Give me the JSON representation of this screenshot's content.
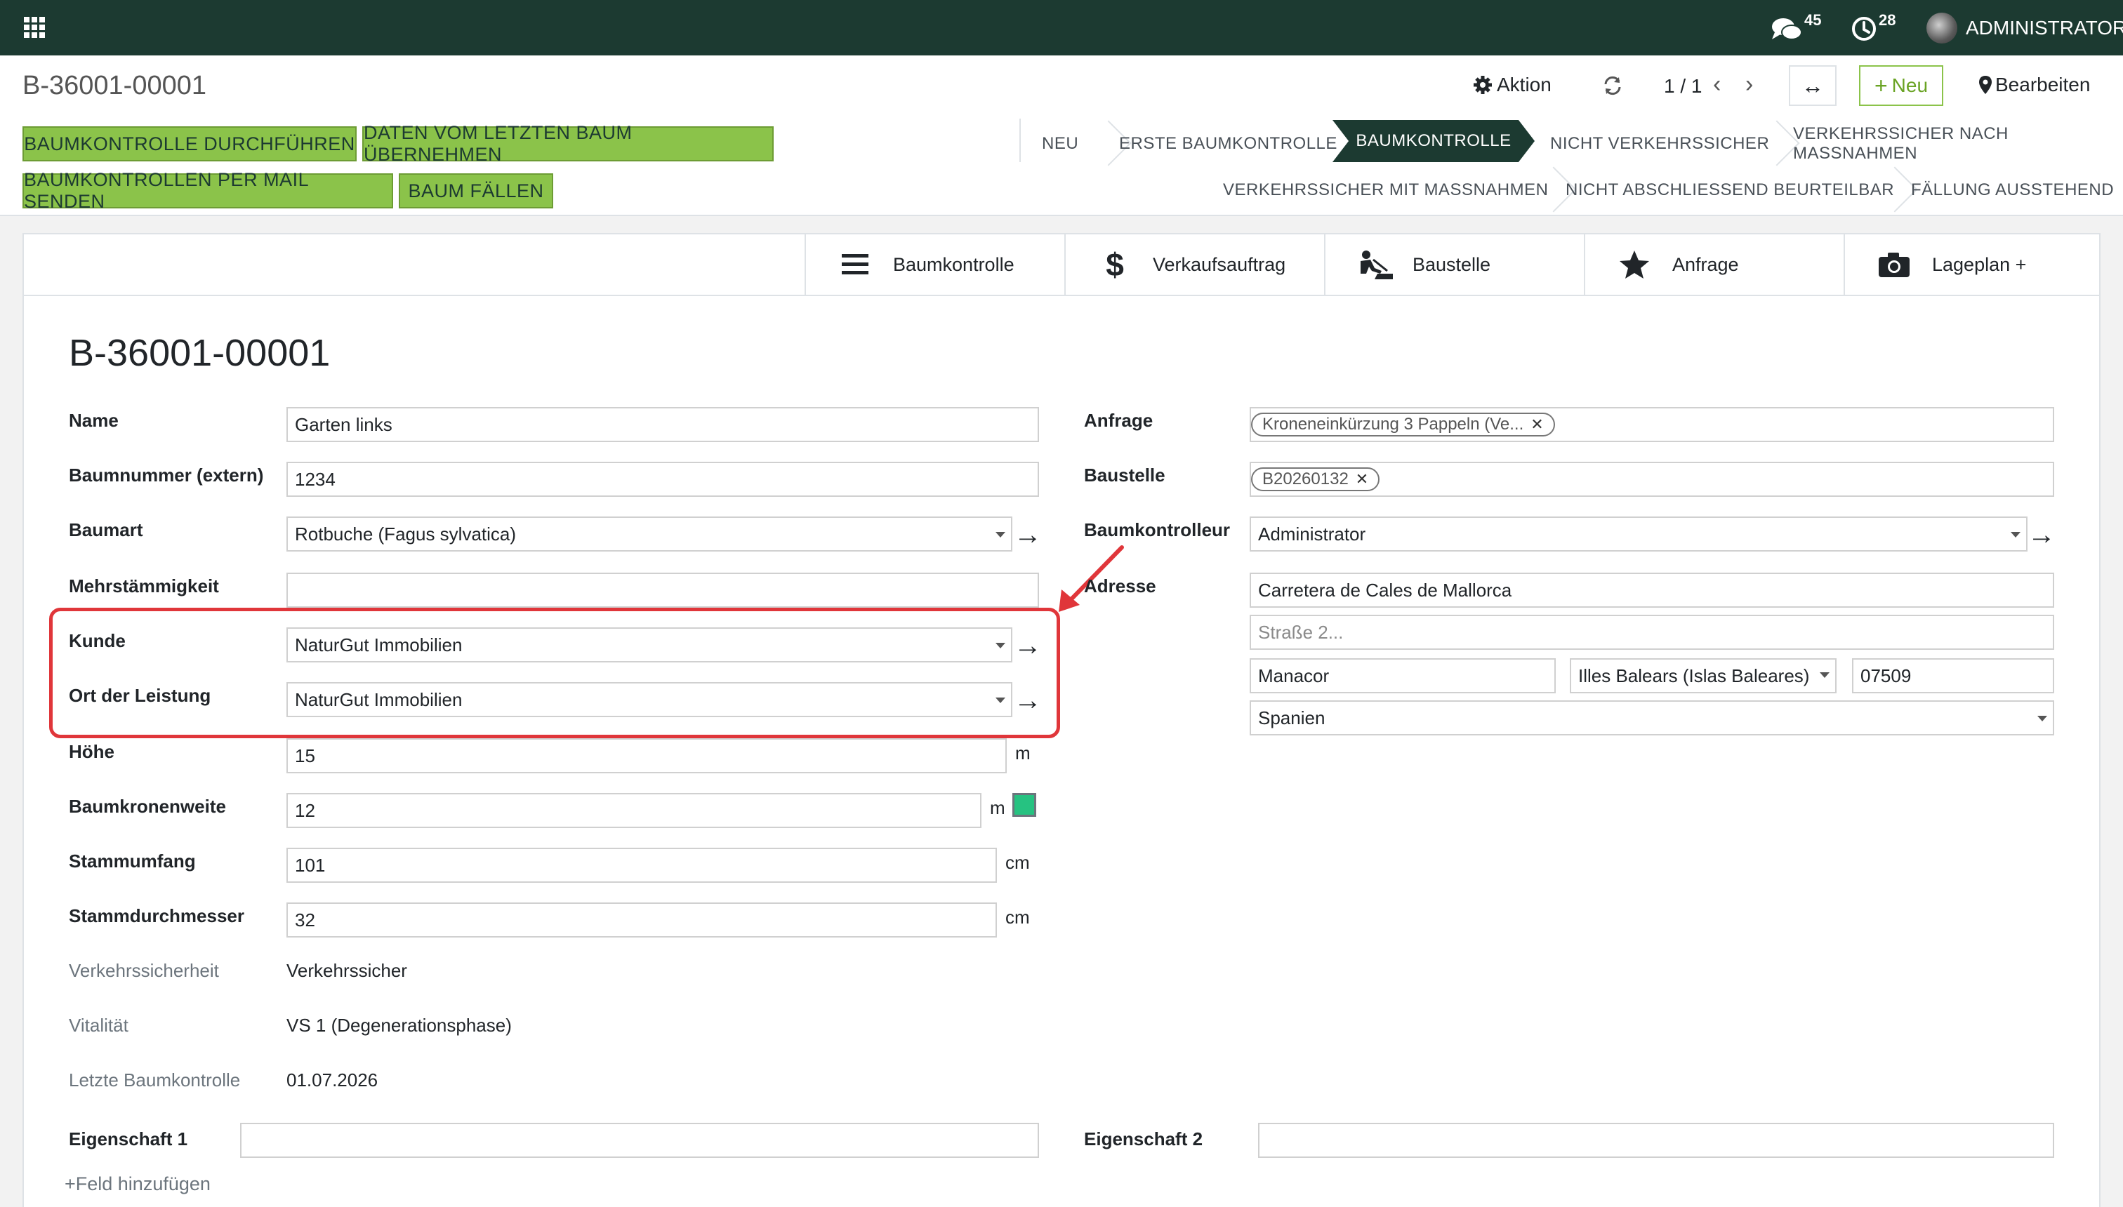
{
  "navbar": {
    "messages_count": "45",
    "activities_count": "28",
    "user_name": "ADMINISTRATOR"
  },
  "control_panel": {
    "breadcrumb": "B-36001-00001",
    "action_label": "Aktion",
    "pager": "1 / 1",
    "new_label": "Neu",
    "edit_label": "Bearbeiten"
  },
  "header_buttons": {
    "perform_check": "BAUMKONTROLLE DURCHFÜHREN",
    "copy_last": "DATEN VOM LETZTEN BAUM ÜBERNEHMEN",
    "send_mail": "BAUMKONTROLLEN PER MAIL SENDEN",
    "fell_tree": "BAUM FÄLLEN"
  },
  "statusbar": {
    "active": "BAUMKONTROLLE",
    "row1": [
      "NEU",
      "ERSTE BAUMKONTROLLE",
      "NICHT VERKEHRSSICHER",
      "VERKEHRSSICHER NACH MASSNAHMEN"
    ],
    "row2": [
      "VERKEHRSSICHER MIT MASSNAHMEN",
      "NICHT ABSCHLIESSEND BEURTEILBAR",
      "FÄLLUNG AUSSTEHEND"
    ]
  },
  "smart_buttons": {
    "check": "Baumkontrolle",
    "sale": "Verkaufsauftrag",
    "site": "Baustelle",
    "request": "Anfrage",
    "map": "Lageplan +"
  },
  "record": {
    "title": "B-36001-00001"
  },
  "left_fields": {
    "name_label": "Name",
    "name_value": "Garten links",
    "ext_label": "Baumnummer (extern)",
    "ext_value": "1234",
    "species_label": "Baumart",
    "species_value": "Rotbuche (Fagus sylvatica)",
    "multi_label": "Mehrstämmigkeit",
    "multi_value": "",
    "customer_label": "Kunde",
    "customer_value": "NaturGut Immobilien",
    "place_label": "Ort der Leistung",
    "place_value": "NaturGut Immobilien",
    "height_label": "Höhe",
    "height_value": "15",
    "height_unit": "m",
    "crown_label": "Baumkronenweite",
    "crown_value": "12",
    "crown_unit": "m",
    "girth_label": "Stammumfang",
    "girth_value": "101",
    "girth_unit": "cm",
    "diameter_label": "Stammdurchmesser",
    "diameter_value": "32",
    "diameter_unit": "cm",
    "safety_label": "Verkehrssicherheit",
    "safety_value": "Verkehrssicher",
    "vitality_label": "Vitalität",
    "vitality_value": "VS 1 (Degenerationsphase)",
    "last_check_label": "Letzte Baumkontrolle",
    "last_check_value": "01.07.2026",
    "prop1_label": "Eigenschaft 1",
    "prop1_value": ""
  },
  "right_fields": {
    "request_label": "Anfrage",
    "request_tag": "Kroneneinkürzung 3 Pappeln (Ve...",
    "site_label": "Baustelle",
    "site_tag": "B20260132",
    "inspector_label": "Baumkontrolleur",
    "inspector_value": "Administrator",
    "address_label": "Adresse",
    "street": "Carretera de Cales de Mallorca",
    "street2_placeholder": "Straße 2...",
    "city": "Manacor",
    "state": "Illes Balears (Islas Baleares)",
    "zip": "07509",
    "country": "Spanien",
    "prop2_label": "Eigenschaft 2",
    "prop2_value": ""
  },
  "footer": {
    "add_field": "+Feld hinzufügen"
  },
  "colors": {
    "navbar": "#1c3a31",
    "header_button": "#8bc34a",
    "highlight": "#e0363a",
    "swatch": "#26c281"
  }
}
